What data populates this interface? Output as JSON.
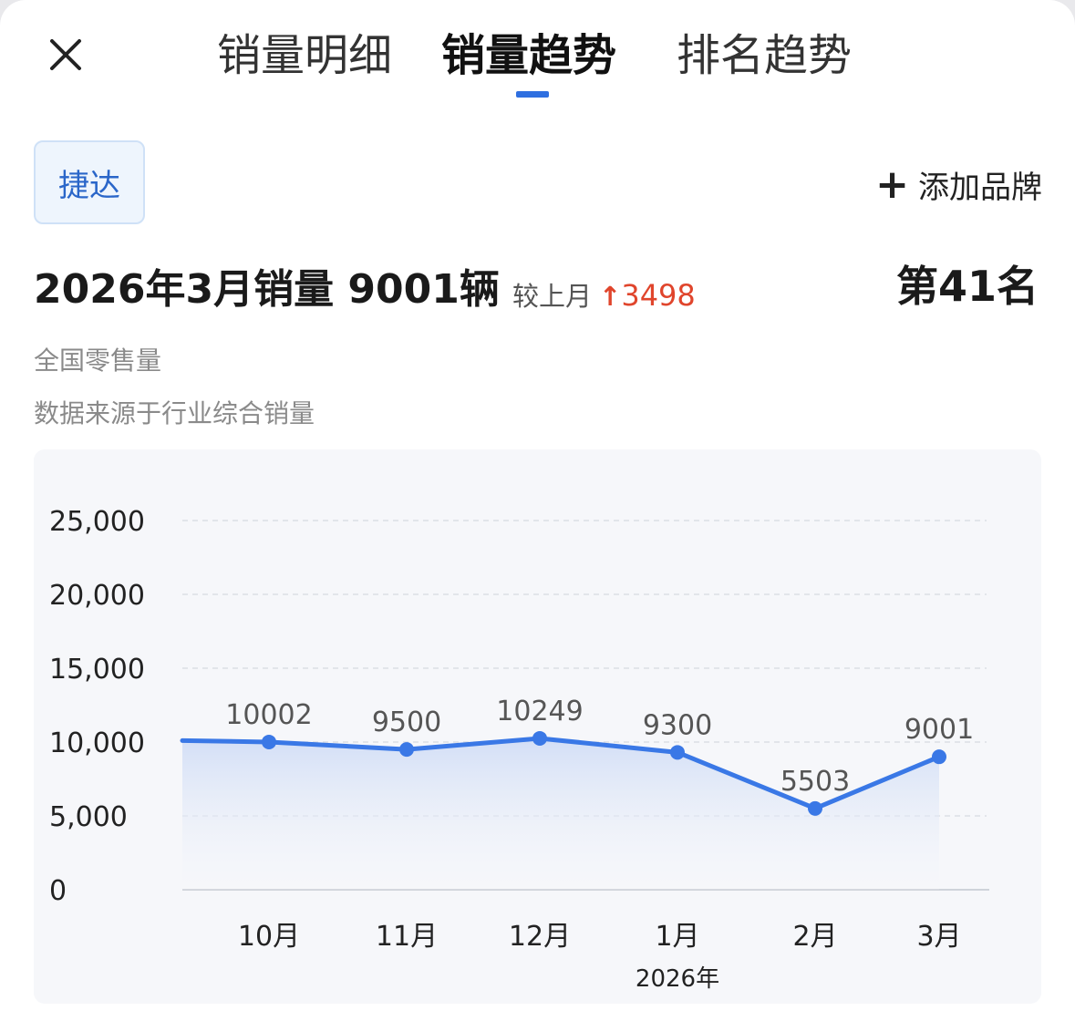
{
  "header": {
    "close_icon": "close-icon",
    "tabs": [
      {
        "label": "销量明细"
      },
      {
        "label": "销量趋势"
      },
      {
        "label": "排名趋势"
      }
    ]
  },
  "brand": {
    "selected": "捷达",
    "add_label": "添加品牌"
  },
  "summary": {
    "headline": "2026年3月销量 9001辆",
    "compare_label": "较上月",
    "compare_delta": "3498",
    "rank": "第41名",
    "scope": "全国零售量",
    "source": "数据来源于行业综合销量"
  },
  "colors": {
    "accent": "#2f6fe0",
    "line": "#3a78e6",
    "up": "#e0452c"
  },
  "chart_data": {
    "type": "line",
    "categories": [
      "10月",
      "11月",
      "12月",
      "1月",
      "2月",
      "3月"
    ],
    "x_sub_labels": [
      "",
      "",
      "",
      "2026年",
      "",
      ""
    ],
    "values": [
      10002,
      9500,
      10249,
      9300,
      5503,
      9001
    ],
    "data_labels": [
      "10002",
      "9500",
      "10249",
      "9300",
      "5503",
      "9001"
    ],
    "leading_value": 10100,
    "yticks": [
      "25,000",
      "20,000",
      "15,000",
      "10,000",
      "5,000",
      "0"
    ],
    "ylim": [
      0,
      25000
    ],
    "grid": true
  }
}
